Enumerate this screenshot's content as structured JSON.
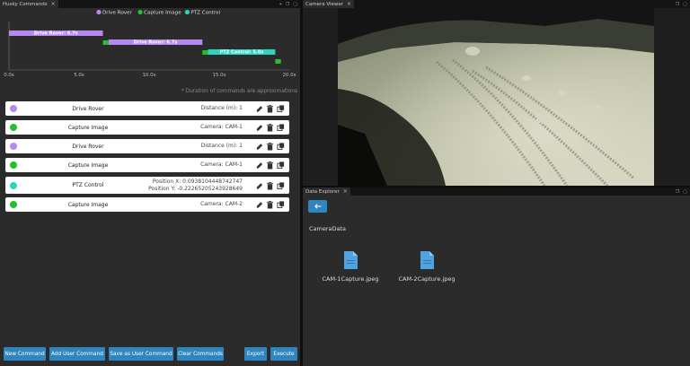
{
  "left_panel": {
    "tab": "Husky Commands"
  },
  "camera_panel": {
    "tab": "Camera Viewer"
  },
  "explorer_panel": {
    "tab": "Data Explorer",
    "folder": "CameraData",
    "files": [
      "CAM-1Capture.jpeg",
      "CAM-2Capture.jpeg"
    ]
  },
  "chart_data": {
    "type": "gantt",
    "legend": [
      {
        "name": "Drive Rover",
        "color": "#b48af0"
      },
      {
        "name": "Capture Image",
        "color": "#22c02a"
      },
      {
        "name": "PTZ Control",
        "color": "#2dd4bf"
      }
    ],
    "x_ticks": [
      "0.0s",
      "5.0s",
      "10.0s",
      "15.0s",
      "20.0s"
    ],
    "xlim": [
      0,
      20
    ],
    "bars": [
      {
        "series": "Drive Rover",
        "start": 0,
        "end": 6.7,
        "label": "Drive Rover: 6.7s"
      },
      {
        "series": "Capture Image",
        "start": 6.7,
        "end": 7.1,
        "label": ""
      },
      {
        "series": "Drive Rover",
        "start": 7.1,
        "end": 13.8,
        "label": "Drive Rover: 6.7s"
      },
      {
        "series": "Capture Image",
        "start": 13.8,
        "end": 14.2,
        "label": ""
      },
      {
        "series": "PTZ Control",
        "start": 14.2,
        "end": 19.0,
        "label": "PTZ Control: 5.0s"
      },
      {
        "series": "Capture Image",
        "start": 19.0,
        "end": 19.4,
        "label": ""
      }
    ],
    "note": "* Duration of commands are approximations"
  },
  "commands": [
    {
      "name": "Drive Rover",
      "color": "#b48af0",
      "detail": [
        "Distance (m): 1"
      ]
    },
    {
      "name": "Capture Image",
      "color": "#22c02a",
      "detail": [
        "Camera: CAM-1"
      ]
    },
    {
      "name": "Drive Rover",
      "color": "#b48af0",
      "detail": [
        "Distance (m): 1"
      ]
    },
    {
      "name": "Capture Image",
      "color": "#22c02a",
      "detail": [
        "Camera: CAM-1"
      ]
    },
    {
      "name": "PTZ Control",
      "color": "#2dd4bf",
      "detail": [
        "Position X: 0.0938104448742747",
        "Position Y: -0.22265205243928649"
      ]
    },
    {
      "name": "Capture Image",
      "color": "#22c02a",
      "detail": [
        "Camera: CAM-2"
      ]
    }
  ],
  "buttons": {
    "new": "New Command",
    "add_user": "Add User Command",
    "save_user": "Save as User Command",
    "clear": "Clear Commands",
    "export": "Export",
    "execute": "Execute"
  },
  "icons": {
    "edit": "pencil-icon",
    "delete": "trash-icon",
    "duplicate": "copy-icon",
    "back": "arrow-left-icon",
    "file": "file-icon"
  }
}
